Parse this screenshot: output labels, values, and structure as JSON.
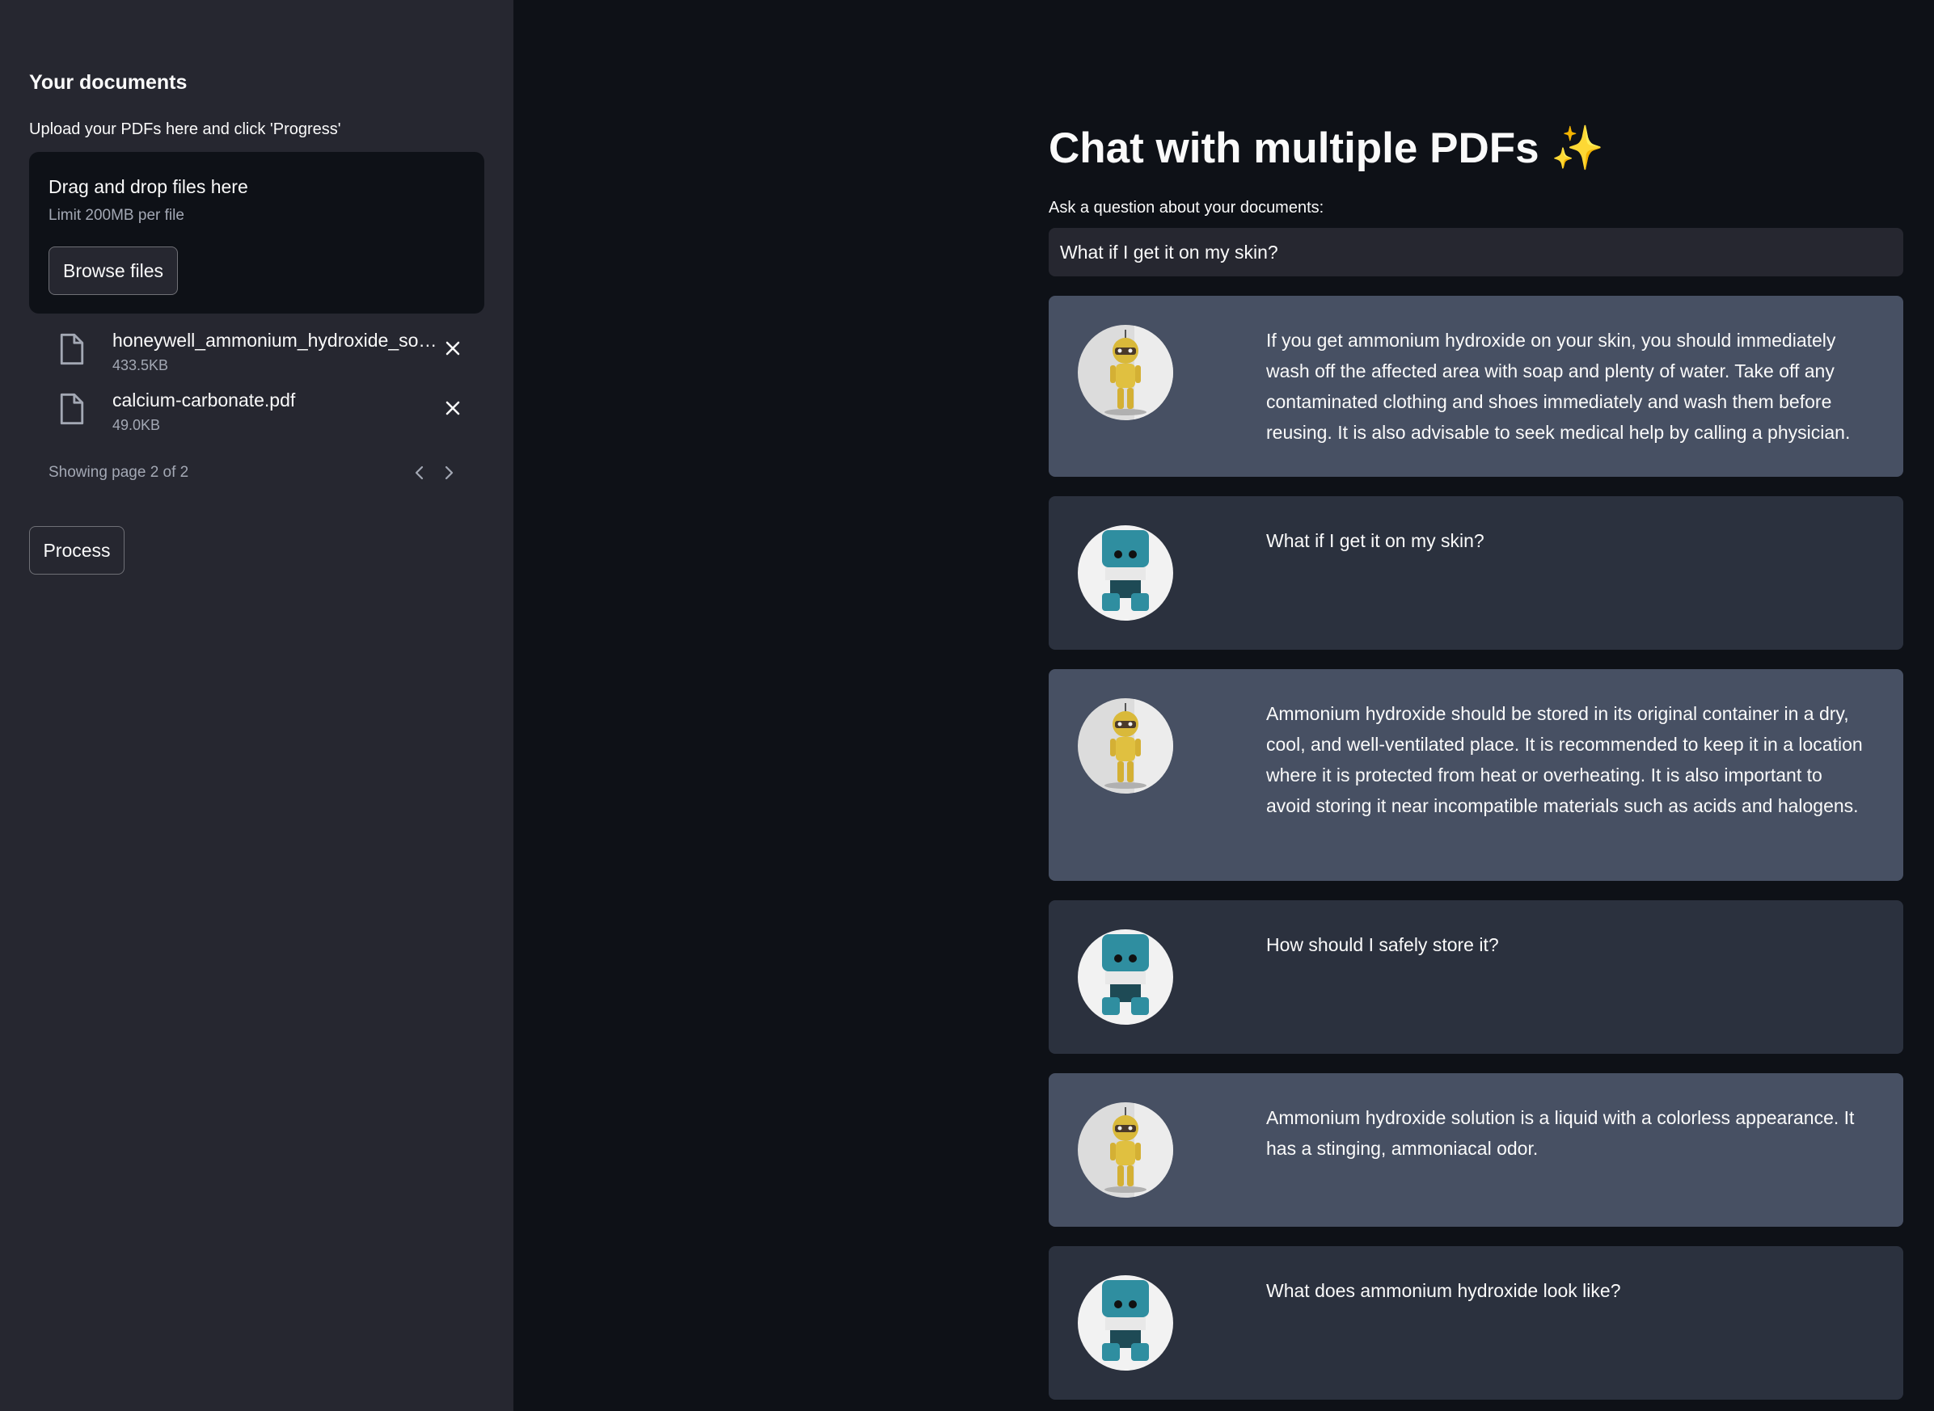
{
  "sidebar": {
    "title": "Your documents",
    "upload_label": "Upload your PDFs here and click 'Progress'",
    "dropzone": {
      "title": "Drag and drop files here",
      "limit": "Limit 200MB per file",
      "browse_label": "Browse files"
    },
    "files": [
      {
        "name": "honeywell_ammonium_hydroxide_so…",
        "size": "433.5KB"
      },
      {
        "name": "calcium-carbonate.pdf",
        "size": "49.0KB"
      }
    ],
    "pager_text": "Showing page 2 of 2",
    "process_label": "Process"
  },
  "main": {
    "title": "Chat with multiple PDFs ✨",
    "ask_label": "Ask a question about your documents:",
    "ask_value": "What if I get it on my skin?",
    "messages": [
      {
        "role": "bot",
        "avatar": "yellow-robot-avatar",
        "text": "If you get ammonium hydroxide on your skin, you should immediately wash off the affected area with soap and plenty of water. Take off any contaminated clothing and shoes immediately and wash them before reusing. It is also advisable to seek medical help by calling a physician."
      },
      {
        "role": "user",
        "avatar": "blue-robot-avatar",
        "text": "What if I get it on my skin?"
      },
      {
        "role": "bot",
        "avatar": "yellow-robot-avatar",
        "text": "Ammonium hydroxide should be stored in its original container in a dry, cool, and well-ventilated place. It is recommended to keep it in a location where it is protected from heat or overheating. It is also important to avoid storing it near incompatible materials such as acids and halogens."
      },
      {
        "role": "user",
        "avatar": "blue-robot-avatar",
        "text": "How should I safely store it?"
      },
      {
        "role": "bot",
        "avatar": "yellow-robot-avatar",
        "text": "Ammonium hydroxide solution is a liquid with a colorless appearance. It has a stinging, ammoniacal odor."
      },
      {
        "role": "user",
        "avatar": "blue-robot-avatar",
        "text": "What does ammonium hydroxide look like?"
      }
    ]
  },
  "colors": {
    "background": "#0e1117",
    "sidebar": "#262730",
    "bot_message": "#475063",
    "user_message": "#2b313e",
    "text": "#fafafa"
  }
}
